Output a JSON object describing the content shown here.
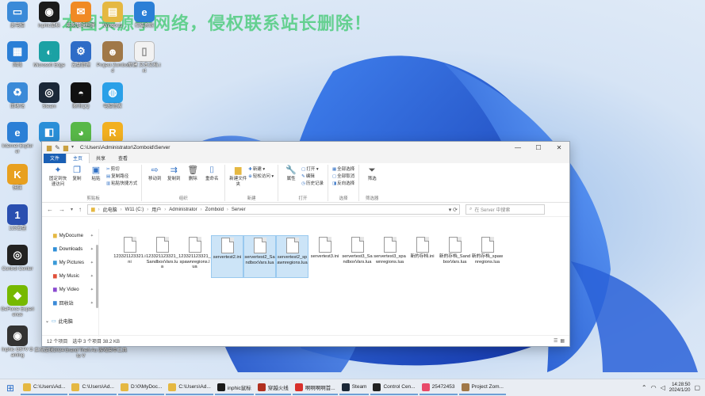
{
  "watermark": "本图来源于网络，侵权联系站长删除！",
  "desktop_icons": [
    {
      "label": "此电脑",
      "color": "#3b8ad8",
      "glyph": "▭"
    },
    {
      "label": "inphic鼠标",
      "color": "#1b1b1b",
      "glyph": "◉"
    },
    {
      "label": "实况足球程序",
      "color": "#f08a24",
      "glyph": "✉"
    },
    {
      "label": "Windows",
      "color": "#e5b842",
      "glyph": "▤"
    },
    {
      "label": "扫描系统",
      "color": "#2b7fd6",
      "glyph": "e"
    },
    {
      "label": "网络",
      "color": "#2b7fd6",
      "glyph": "▦"
    },
    {
      "label": "Microsoft Edge",
      "color": "#1ba1a4",
      "glyph": "◐"
    },
    {
      "label": "云盘管理",
      "color": "#2e6cc7",
      "glyph": "⚙"
    },
    {
      "label": "Project Zomboid",
      "color": "#a07848",
      "glyph": "☻"
    },
    {
      "label": "新建 文本文档.txt",
      "color": "#f2f2f2",
      "glyph": "▯"
    },
    {
      "label": "回收站",
      "color": "#3b8ad8",
      "glyph": "♻"
    },
    {
      "label": "Steam",
      "color": "#1b2838",
      "glyph": "◎"
    },
    {
      "label": "腾讯QQ",
      "color": "#111111",
      "glyph": "◓"
    },
    {
      "label": "电脑管家",
      "color": "#2aa0e8",
      "glyph": "◍"
    },
    {
      "label": "Internet Explorer",
      "color": "#2b7fd6",
      "glyph": "e"
    },
    {
      "label": "",
      "color": "#2a8fd8",
      "glyph": "◧"
    },
    {
      "label": "",
      "color": "#58b848",
      "glyph": "◕"
    },
    {
      "label": "",
      "color": "#f2b020",
      "glyph": "R"
    },
    {
      "label": "快压",
      "color": "#e8a020",
      "glyph": "K"
    },
    {
      "label": "123云盘",
      "color": "#2a4fb0",
      "glyph": "1"
    },
    {
      "label": "Control Center",
      "color": "#222222",
      "glyph": "◎"
    },
    {
      "label": "GeForce Experience",
      "color": "#76b900",
      "glyph": "◆"
    },
    {
      "label": "Inphic G6TV Gaming",
      "color": "#333333",
      "glyph": "◉"
    }
  ],
  "bottom_icon_labels": [
    "Inphic G6TV Gaming",
    "实况足球2024",
    "Grand Theft Auto V",
    "游戏菜单工具"
  ],
  "window": {
    "title_path": "C:\\Users\\Administrator\\Zomboid\\Server",
    "controls": [
      "—",
      "☐",
      "✕"
    ],
    "tabs": [
      "文件",
      "主页",
      "共享",
      "查看"
    ],
    "active_tab": "主页",
    "ribbon": {
      "clipboard": {
        "name": "剪贴板",
        "pin": "固定到快速访问",
        "copy": "复制",
        "paste": "粘贴",
        "cut": "剪切",
        "copy_path": "复制路径",
        "paste_shortcut": "粘贴快捷方式"
      },
      "organize": {
        "name": "组织",
        "move_to": "移动到",
        "copy_to": "复制到",
        "delete": "删除",
        "rename": "重命名"
      },
      "new": {
        "name": "新建",
        "new_folder": "新建文件夹",
        "new_item": "新建 ▾",
        "easy_access": "轻松访问 ▾"
      },
      "open": {
        "name": "打开",
        "properties": "属性",
        "open": "打开 ▾",
        "edit": "编辑",
        "history": "历史记录"
      },
      "select": {
        "name": "选择",
        "select_all": "全部选择",
        "select_none": "全部取消",
        "invert": "反向选择"
      },
      "filter": {
        "name": "筛选器",
        "filter": "筛选"
      }
    },
    "breadcrumb": [
      "此电脑",
      "W11 (C:)",
      "用户",
      "Administrator",
      "Zomboid",
      "Server"
    ],
    "search_placeholder": "在 Server 中搜索",
    "nav_items": [
      "MyDocume",
      "Downloads",
      "My Pictures",
      "My Music",
      "My Video",
      "回收站"
    ],
    "this_pc": "此电脑",
    "files": [
      {
        "name": "123321123321.ini",
        "selected": false
      },
      {
        "name": "123321123321_SandboxVars.lua",
        "selected": false
      },
      {
        "name": "123321123321_spawnregions.lua",
        "selected": false
      },
      {
        "name": "servertest2.ini",
        "selected": true
      },
      {
        "name": "servertest2_SandboxVars.lua",
        "selected": true
      },
      {
        "name": "servertest2_spawnregions.lua",
        "selected": true
      },
      {
        "name": "servertest3.ini",
        "selected": false
      },
      {
        "name": "servertest3_SandboxVars.lua",
        "selected": false
      },
      {
        "name": "servertest3_spawnregions.lua",
        "selected": false
      },
      {
        "name": "新的存档.ini",
        "selected": false
      },
      {
        "name": "新的存档_SandboxVars.lua",
        "selected": false
      },
      {
        "name": "新的存档_spawnregions.lua",
        "selected": false
      }
    ],
    "status": {
      "count": "12 个项目",
      "selection": "选中 3 个项目 38.2 KB"
    }
  },
  "taskbar": {
    "items": [
      {
        "label": "C:\\Users\\Ad...",
        "color": "#e5b842"
      },
      {
        "label": "C:\\Users\\Ad...",
        "color": "#e5b842"
      },
      {
        "label": "D:\\0\\MyDoc...",
        "color": "#e5b842"
      },
      {
        "label": "C:\\Users\\Ad...",
        "color": "#e5b842"
      },
      {
        "label": "inphic鼠标",
        "color": "#1b1b1b"
      },
      {
        "label": "穿越火线",
        "color": "#b03020"
      },
      {
        "label": "啊啊啊啊首...",
        "color": "#d8302c"
      },
      {
        "label": "Steam",
        "color": "#1b2838"
      },
      {
        "label": "Control Cen...",
        "color": "#222222"
      },
      {
        "label": "25472453",
        "color": "#e84a6a"
      },
      {
        "label": "Project Zom...",
        "color": "#a07848"
      }
    ],
    "time": "14:28:50",
    "date": "2024/1/20"
  }
}
